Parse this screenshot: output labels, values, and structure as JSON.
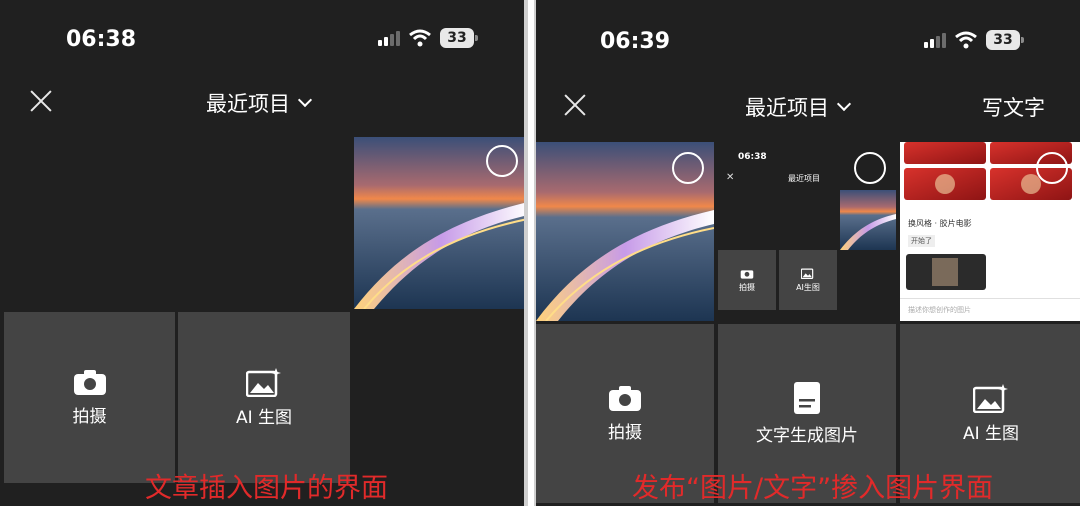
{
  "left": {
    "status_time": "06:38",
    "battery": "33",
    "title": "最近项目",
    "tiles": [
      {
        "label": "拍摄",
        "icon": "camera-icon"
      },
      {
        "label": "AI 生图",
        "icon": "ai-image-icon"
      }
    ],
    "caption": "文章插入图片的界面"
  },
  "right": {
    "status_time": "06:39",
    "battery": "33",
    "title": "最近项目",
    "write_text": "写文字",
    "mini_screenshot": {
      "time": "06:38",
      "title": "最近项目",
      "tiles": [
        "拍摄",
        "AI生图"
      ]
    },
    "card": {
      "style_text": "换风格 · 胶片电影",
      "button_text": "开始了",
      "prompt_placeholder": "描述你想创作的图片"
    },
    "tiles": [
      {
        "label": "拍摄",
        "icon": "camera-icon"
      },
      {
        "label": "文字生成图片",
        "icon": "text-image-icon"
      },
      {
        "label": "AI 生图",
        "icon": "ai-image-icon"
      }
    ],
    "caption": "发布“图片/文字”掺入图片界面"
  },
  "colors": {
    "background": "#202020",
    "tile": "#444444",
    "caption": "#e12a2a"
  }
}
